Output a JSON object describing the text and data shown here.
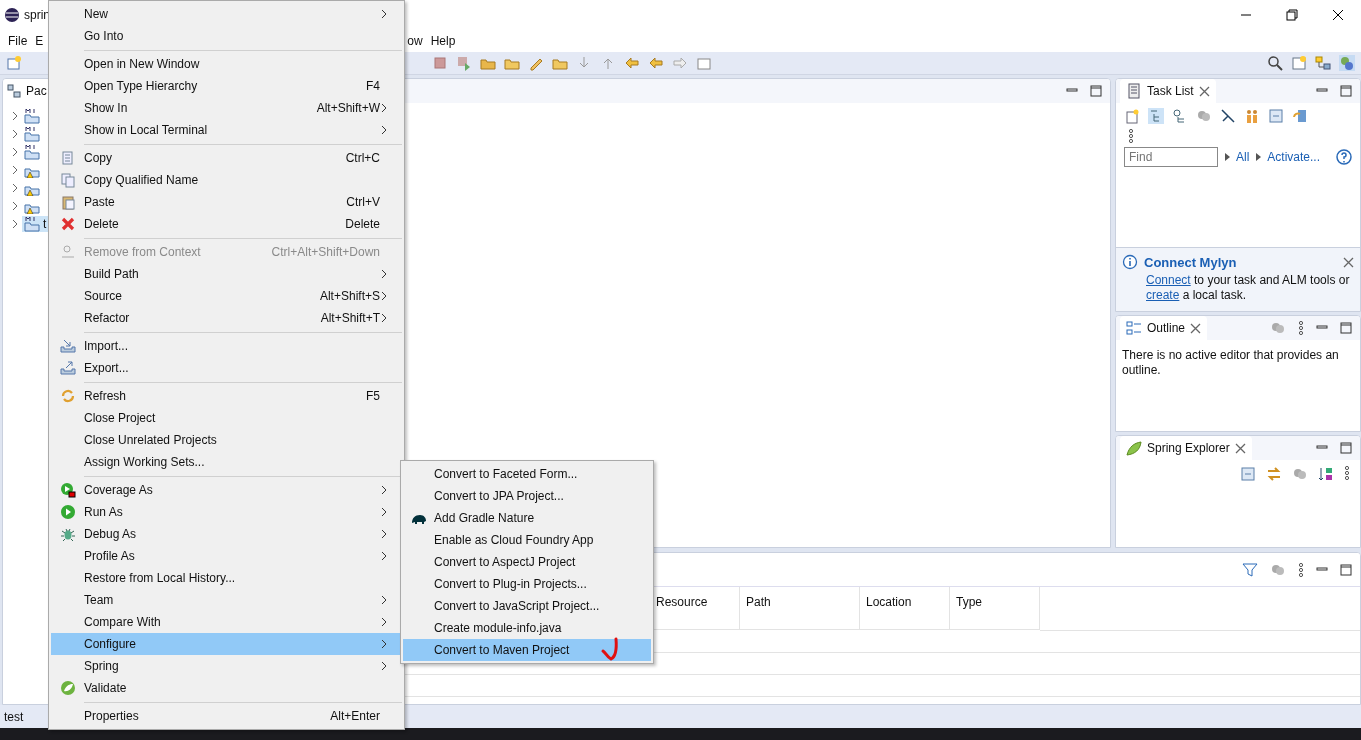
{
  "window": {
    "title": "sprin"
  },
  "menu_bar": [
    "File",
    "E",
    "ow",
    "Help"
  ],
  "package_explorer": {
    "tab": "Pac",
    "items": [
      {
        "warning": false,
        "selected": false
      },
      {
        "warning": false,
        "selected": false
      },
      {
        "warning": false,
        "selected": false
      },
      {
        "warning": true,
        "selected": false
      },
      {
        "warning": true,
        "selected": false
      },
      {
        "warning": true,
        "selected": false
      },
      {
        "label": "t",
        "warning": false,
        "selected": true
      }
    ]
  },
  "context_menu": [
    {
      "kind": "item",
      "label": "New",
      "submenu": true,
      "selected": false
    },
    {
      "kind": "item",
      "label": "Go Into",
      "selected": false
    },
    {
      "kind": "separator"
    },
    {
      "kind": "item",
      "label": "Open in New Window",
      "selected": false
    },
    {
      "kind": "item",
      "label": "Open Type Hierarchy",
      "shortcut": "F4",
      "selected": false
    },
    {
      "kind": "item",
      "label": "Show In",
      "shortcut": "Alt+Shift+W",
      "submenu": true,
      "selected": false
    },
    {
      "kind": "item",
      "label": "Show in Local Terminal",
      "submenu": true,
      "selected": false
    },
    {
      "kind": "separator"
    },
    {
      "kind": "item",
      "label": "Copy",
      "shortcut": "Ctrl+C",
      "selected": false
    },
    {
      "kind": "item",
      "label": "Copy Qualified Name",
      "selected": false
    },
    {
      "kind": "item",
      "label": "Paste",
      "shortcut": "Ctrl+V",
      "selected": false
    },
    {
      "kind": "item",
      "label": "Delete",
      "shortcut": "Delete",
      "selected": false
    },
    {
      "kind": "separator"
    },
    {
      "kind": "item",
      "label": "Remove from Context",
      "shortcut": "Ctrl+Alt+Shift+Down",
      "disabled": true,
      "selected": false
    },
    {
      "kind": "item",
      "label": "Build Path",
      "submenu": true,
      "selected": false
    },
    {
      "kind": "item",
      "label": "Source",
      "shortcut": "Alt+Shift+S",
      "submenu": true,
      "selected": false
    },
    {
      "kind": "item",
      "label": "Refactor",
      "shortcut": "Alt+Shift+T",
      "submenu": true,
      "selected": false
    },
    {
      "kind": "separator"
    },
    {
      "kind": "item",
      "label": "Import...",
      "selected": false
    },
    {
      "kind": "item",
      "label": "Export...",
      "selected": false
    },
    {
      "kind": "separator"
    },
    {
      "kind": "item",
      "label": "Refresh",
      "shortcut": "F5",
      "selected": false
    },
    {
      "kind": "item",
      "label": "Close Project",
      "selected": false
    },
    {
      "kind": "item",
      "label": "Close Unrelated Projects",
      "selected": false
    },
    {
      "kind": "item",
      "label": "Assign Working Sets...",
      "selected": false
    },
    {
      "kind": "separator"
    },
    {
      "kind": "item",
      "label": "Coverage As",
      "submenu": true,
      "selected": false
    },
    {
      "kind": "item",
      "label": "Run As",
      "submenu": true,
      "selected": false
    },
    {
      "kind": "item",
      "label": "Debug As",
      "submenu": true,
      "selected": false
    },
    {
      "kind": "item",
      "label": "Profile As",
      "submenu": true,
      "selected": false
    },
    {
      "kind": "item",
      "label": "Restore from Local History...",
      "selected": false
    },
    {
      "kind": "item",
      "label": "Team",
      "submenu": true,
      "selected": false
    },
    {
      "kind": "item",
      "label": "Compare With",
      "submenu": true,
      "selected": false
    },
    {
      "kind": "item",
      "label": "Configure",
      "submenu": true,
      "selected": true
    },
    {
      "kind": "item",
      "label": "Spring",
      "submenu": true,
      "selected": false
    },
    {
      "kind": "item",
      "label": "Validate",
      "selected": false
    },
    {
      "kind": "separator"
    },
    {
      "kind": "item",
      "label": "Properties",
      "shortcut": "Alt+Enter",
      "selected": false
    }
  ],
  "configure_submenu": [
    {
      "label": "Convert to Faceted Form...",
      "selected": false
    },
    {
      "label": "Convert to JPA Project...",
      "selected": false
    },
    {
      "label": "Add Gradle Nature",
      "selected": false
    },
    {
      "label": "Enable as Cloud Foundry App",
      "selected": false
    },
    {
      "label": "Convert to AspectJ Project",
      "selected": false
    },
    {
      "label": "Convert to Plug-in Projects...",
      "selected": false
    },
    {
      "label": "Convert to JavaScript Project...",
      "selected": false
    },
    {
      "label": "Create module-info.java",
      "selected": false
    },
    {
      "label": "Convert to Maven Project",
      "selected": true
    }
  ],
  "task_list": {
    "tab": "Task List",
    "find_placeholder": "Find",
    "filters": [
      "All",
      "Activate..."
    ],
    "connect_mylyn": {
      "title": "Connect Mylyn",
      "parts": [
        {
          "text": "Connect",
          "link": true
        },
        {
          "text": " to your task and ALM tools or ",
          "link": false
        },
        {
          "text": "create",
          "link": true
        },
        {
          "text": " a local task.",
          "link": false
        }
      ]
    }
  },
  "outline": {
    "tab": "Outline",
    "message": "There is no active editor that provides an outline."
  },
  "spring_explorer": {
    "tab": "Spring Explorer"
  },
  "bottom_panel": {
    "columns": [
      "Resource",
      "Path",
      "Location",
      "Type"
    ]
  },
  "status_bar": {
    "text": "test"
  }
}
